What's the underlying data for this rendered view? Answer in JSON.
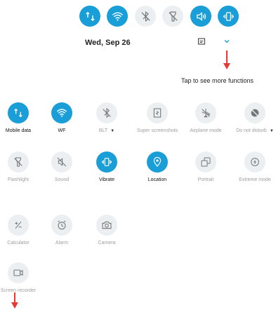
{
  "status_row": {
    "buttons": [
      {
        "name": "mobile-data-icon",
        "active": true
      },
      {
        "name": "wifi-icon",
        "active": true
      },
      {
        "name": "bluetooth-off-icon",
        "active": false
      },
      {
        "name": "flashlight-off-icon",
        "active": false
      },
      {
        "name": "sound-icon",
        "active": true
      },
      {
        "name": "vibrate-icon",
        "active": true
      }
    ]
  },
  "header": {
    "date": "Wed, Sep 26",
    "edit_icon": "edit-icon",
    "expand_icon": "chevron-down-icon"
  },
  "annotation": {
    "hint": "Tap to see more functions"
  },
  "tiles": [
    {
      "label": "Mobile data",
      "icon": "mobile-data-icon",
      "active": true,
      "dropdown": false
    },
    {
      "label": "WF",
      "icon": "wifi-icon",
      "active": true,
      "dropdown": false
    },
    {
      "label": "BLT",
      "icon": "bluetooth-off-icon",
      "active": false,
      "dropdown": true
    },
    {
      "label": "Super screenshots",
      "icon": "screenshot-icon",
      "active": false,
      "dropdown": false
    },
    {
      "label": "Airplane mode",
      "icon": "airplane-off-icon",
      "active": false,
      "dropdown": false
    },
    {
      "label": "Do not disturb",
      "icon": "dnd-icon",
      "active": false,
      "dropdown": true
    },
    {
      "label": "Flashlight",
      "icon": "flashlight-off-icon",
      "active": false,
      "dropdown": false
    },
    {
      "label": "Sound",
      "icon": "sound-off-icon",
      "active": false,
      "dropdown": false
    },
    {
      "label": "Vibrate",
      "icon": "vibrate-icon",
      "active": true,
      "dropdown": false
    },
    {
      "label": "Location",
      "icon": "location-icon",
      "active": true,
      "dropdown": false
    },
    {
      "label": "Portrait",
      "icon": "portrait-icon",
      "active": false,
      "dropdown": false
    },
    {
      "label": "Extreme mode",
      "icon": "extreme-mode-icon",
      "active": false,
      "dropdown": false
    },
    {
      "label": "Calculator",
      "icon": "calculator-icon",
      "active": false,
      "dropdown": false
    },
    {
      "label": "Alarm",
      "icon": "alarm-icon",
      "active": false,
      "dropdown": false
    },
    {
      "label": "Camera",
      "icon": "camera-icon",
      "active": false,
      "dropdown": false
    },
    {
      "label": "Screen recorder",
      "icon": "screen-recorder-icon",
      "active": false,
      "dropdown": false
    }
  ],
  "colors": {
    "accent": "#1a9ed8",
    "inactive": "#eceff1",
    "arrow": "#e53935"
  }
}
